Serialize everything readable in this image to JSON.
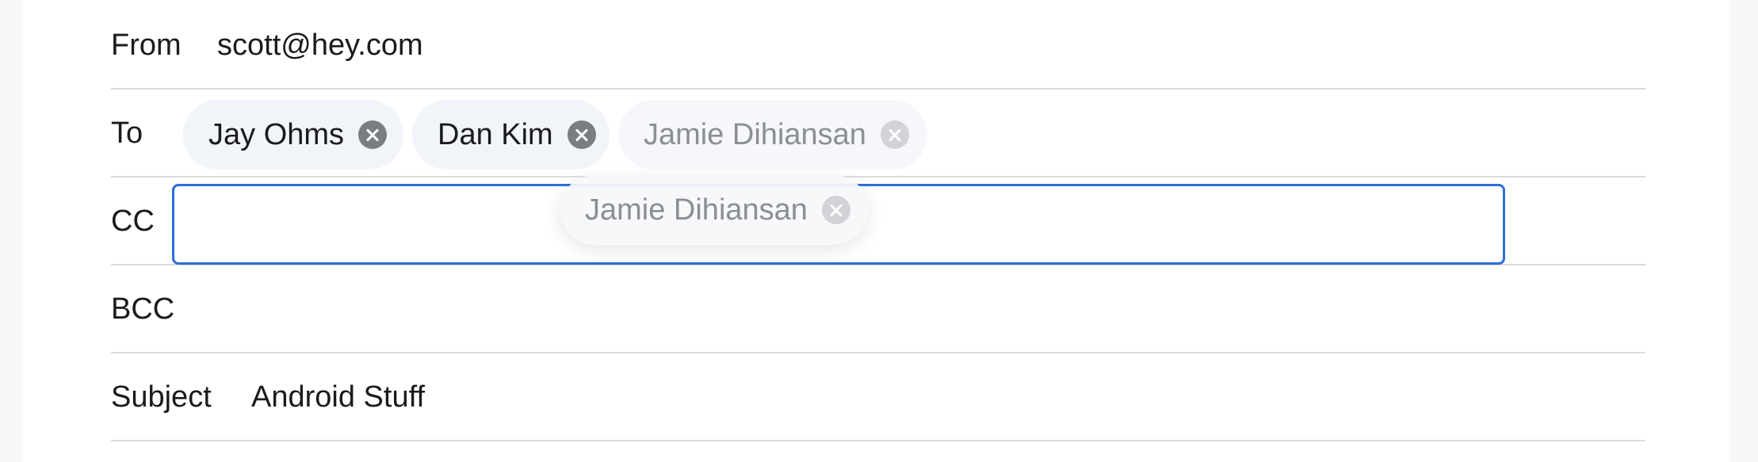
{
  "compose": {
    "from": {
      "label": "From",
      "value": "scott@hey.com"
    },
    "to": {
      "label": "To",
      "recipients": [
        {
          "name": "Jay Ohms",
          "state": "normal"
        },
        {
          "name": "Dan Kim",
          "state": "normal"
        },
        {
          "name": "Jamie Dihiansan",
          "state": "placeholder"
        }
      ]
    },
    "cc": {
      "label": "CC",
      "value": ""
    },
    "dragging_chip": {
      "name": "Jamie Dihiansan"
    },
    "bcc": {
      "label": "BCC"
    },
    "subject": {
      "label": "Subject",
      "value": "Android Stuff"
    }
  },
  "colors": {
    "focus_border": "#2d6fd6",
    "chip_background": "#f1f4f9",
    "divider": "#dcdcdc"
  }
}
